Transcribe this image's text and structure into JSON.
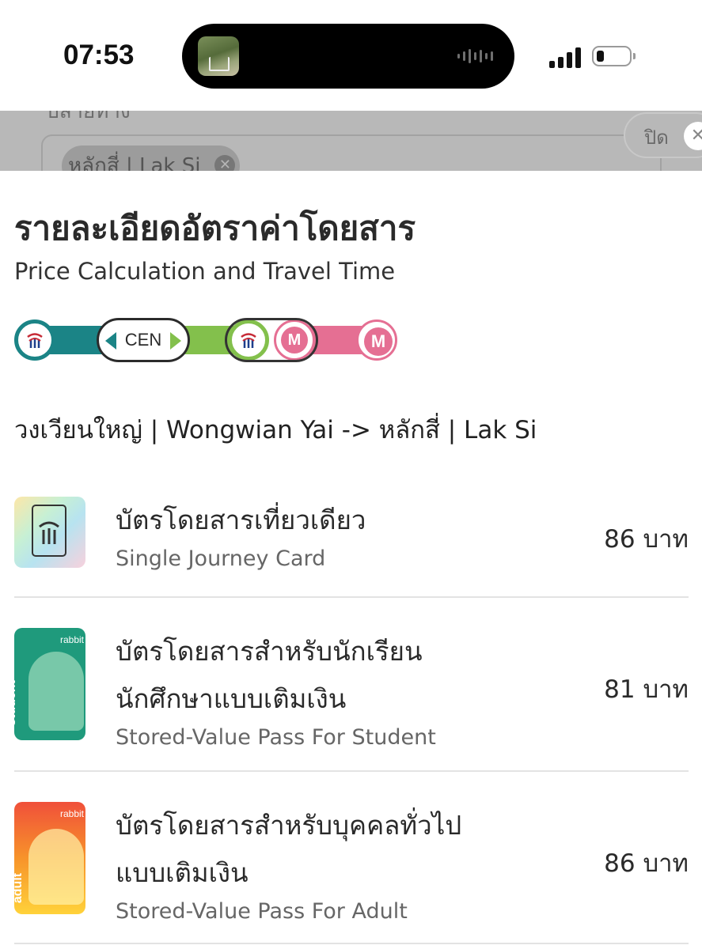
{
  "status_bar": {
    "time": "07:53",
    "icons": [
      "now-playing-thumbnail",
      "audio-waveform-icon",
      "cellular-signal-icon",
      "battery-icon"
    ],
    "battery_level": 0.2
  },
  "background_page": {
    "chip_label": "หลักสี่ | Lak Si",
    "close_label": "ปิด"
  },
  "sheet": {
    "title": "รายละเอียดอัตราค่าโดยสาร",
    "subtitle": "Price Calculation and Travel Time",
    "route_strip": {
      "interchange_label": "CEN",
      "line_colors": {
        "silom": "#1b8486",
        "sukhumvit": "#83c04c",
        "pink": "#e56f93"
      },
      "mrt_glyph": "M"
    },
    "route_text": "วงเวียนใหญ่ | Wongwian Yai -> หลักสี่ | Lak Si",
    "fares": [
      {
        "name_th": "บัตรโดยสารเที่ยวเดียว",
        "name_en": "Single Journey Card",
        "price": "86 บาท",
        "card_icon": "single-journey-card-icon"
      },
      {
        "name_th_line1": "บัตรโดยสารสำหรับนักเรียน",
        "name_th_line2": "นักศึกษาแบบเติมเงิน",
        "name_en": "Stored-Value Pass For Student",
        "price": "81 บาท",
        "card_icon": "rabbit-student-card-icon",
        "card_label": "student",
        "card_brand": "rabbit"
      },
      {
        "name_th_line1": "บัตรโดยสารสำหรับบุคคลทั่วไป",
        "name_th_line2": "แบบเติมเงิน",
        "name_en": "Stored-Value Pass For Adult",
        "price": "86 บาท",
        "card_icon": "rabbit-adult-card-icon",
        "card_label": "adult",
        "card_brand": "rabbit"
      }
    ]
  }
}
